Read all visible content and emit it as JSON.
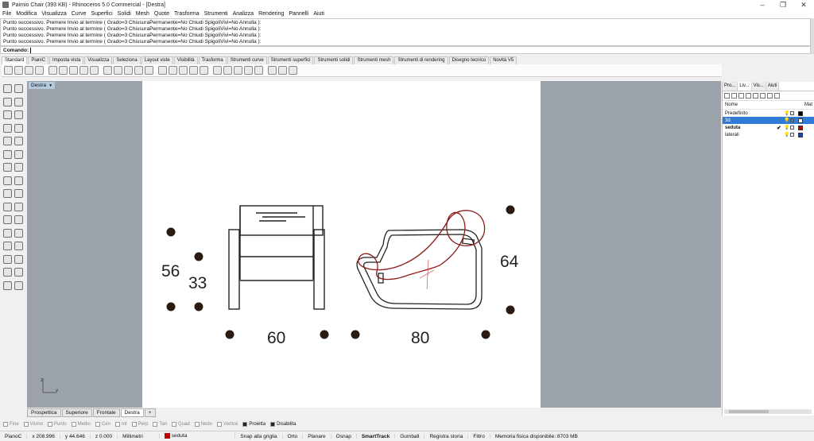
{
  "window": {
    "title": "Paimio Chair (393 KB) - Rhinoceros 5.0 Commercial - [Destra]"
  },
  "menu": [
    "File",
    "Modifica",
    "Visualizza",
    "Curve",
    "Superfici",
    "Solidi",
    "Mesh",
    "Quote",
    "Trasforma",
    "Strumenti",
    "Analizza",
    "Rendering",
    "Pannelli",
    "Aiuti"
  ],
  "command": {
    "history": [
      "Punto successivo. Premere Invio al termine ( Grado=3  ChiusuraPermanente=No  Chiudi  SpigoliVivi=No  Annulla ):",
      "Punto successivo. Premere Invio al termine ( Grado=3  ChiusuraPermanente=No  Chiudi  SpigoliVivi=No  Annulla ):",
      "Punto successivo. Premere Invio al termine ( Grado=3  ChiusuraPermanente=No  Chiudi  SpigoliVivi=No  Annulla ):",
      "Punto successivo. Premere Invio al termine ( Grado=3  ChiusuraPermanente=No  Chiudi  SpigoliVivi=No  Annulla ):"
    ],
    "prompt": "Comando:"
  },
  "toolbar_tabs": [
    "Standard",
    "PianiC",
    "Imposta vista",
    "Visualizza",
    "Seleziona",
    "Layout viste",
    "Visibilità",
    "Trasforma",
    "Strumenti curve",
    "Strumenti superfici",
    "Strumenti solidi",
    "Strumenti mesh",
    "Strumenti di rendering",
    "Disegno tecnico",
    "Novità V5"
  ],
  "viewport": {
    "label": "Destra",
    "axis_z": "z",
    "axis_y": "y",
    "dimensions": [
      "56",
      "33",
      "60",
      "80",
      "64"
    ]
  },
  "view_tabs": [
    "Prospettica",
    "Superiore",
    "Frontale",
    "Destra",
    "+"
  ],
  "layers_panel": {
    "tabs": [
      "Pro...",
      "Liv...",
      "Vis...",
      "Aiuti"
    ],
    "column_name": "Nome",
    "column_mat": "Mat",
    "layers": [
      {
        "name": "Predefinito",
        "color": "#000000",
        "state": ""
      },
      {
        "name": "3d",
        "color": "#ffffff",
        "state": "selected"
      },
      {
        "name": "seduta",
        "color": "#c00000",
        "state": "current"
      },
      {
        "name": "laterali",
        "color": "#1f3fbf",
        "state": ""
      }
    ]
  },
  "osnap": [
    "Fine",
    "Vicino",
    "Punto",
    "Medio",
    "Cen",
    "Int",
    "Perp",
    "Tan",
    "Quad",
    "Nodo",
    "Vertice",
    "Proietta",
    "Disabilita"
  ],
  "status": {
    "cplane": "PianoC",
    "x": "x 208.996",
    "y": "y 44.646",
    "z": "z 0.000",
    "units": "Millimetri",
    "layer": "seduta",
    "items": [
      "Snap alla griglia",
      "Orto",
      "Planare",
      "Osnap",
      "SmartTrack",
      "Gumball",
      "Registra storia",
      "Filtro"
    ],
    "memory": "Memoria fisica disponibile: 8703 MB"
  },
  "colors": {
    "viewport_bg": "#9ca2aa",
    "selection": "#2f7bd6",
    "seat_curve": "#8b1a1a"
  }
}
